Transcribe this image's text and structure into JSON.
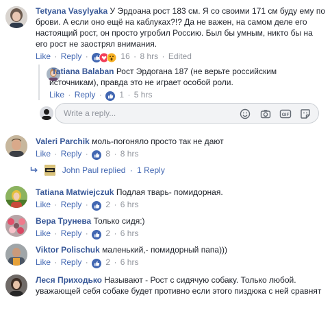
{
  "comments": [
    {
      "author": "Tetyana Vasylyaka",
      "text": "У Эрдоана рост 183 см. Я со своими 171 см буду ему по брови. А если оно ещё на каблуках?!? Да не важен, на самом деле его настоящий рост, он просто угробил Россию. Был бы умным, никто бы на его рост не заострял внимания.",
      "like": "Like",
      "reply": "Reply",
      "reaction_count": "16",
      "time": "8 hrs",
      "edited": "Edited",
      "reactions": [
        "like-reaction-icon",
        "love-reaction-icon",
        "wow-reaction-icon"
      ]
    },
    {
      "author": "Tatiana Balaban",
      "text": "Рост Эрдогана 187 (не верьте российским источникам), правда это не играет особой роли.",
      "like": "Like",
      "reply": "Reply",
      "reaction_count": "1",
      "time": "5 hrs",
      "reactions": [
        "like-reaction-icon"
      ]
    },
    {
      "author": "Valeri Parchik",
      "text": "моль-погоняло просто так не дают",
      "like": "Like",
      "reply": "Reply",
      "reaction_count": "8",
      "time": "8 hrs",
      "reactions": [
        "like-reaction-icon"
      ]
    },
    {
      "author": "Tatiana Matwiejczuk",
      "text": "Подлая тварь- помидорная.",
      "like": "Like",
      "reply": "Reply",
      "reaction_count": "2",
      "time": "6 hrs",
      "reactions": [
        "like-reaction-icon"
      ]
    },
    {
      "author": "Вера Трунева",
      "text": "Только сидя:)",
      "like": "Like",
      "reply": "Reply",
      "reaction_count": "2",
      "time": "6 hrs",
      "reactions": [
        "like-reaction-icon"
      ]
    },
    {
      "author": "Viktor Polischuk",
      "text": "маленький,- помидорный папа)))",
      "like": "Like",
      "reply": "Reply",
      "reaction_count": "2",
      "time": "6 hrs",
      "reactions": [
        "like-reaction-icon"
      ]
    },
    {
      "author": "Леся Приходько",
      "text": "Называют - Рост с сидячую собаку. Только любой. уважающей себя собаке будет противно если этого пиздюка с ней сравнят",
      "like": "",
      "reply": "",
      "reaction_count": "",
      "time": "",
      "reactions": []
    }
  ],
  "write_reply": {
    "placeholder": "Write a reply...",
    "tools": [
      "emoji-icon",
      "camera-icon",
      "gif-icon",
      "sticker-icon"
    ]
  },
  "replied_summary": {
    "name": "John Paul",
    "action": "replied",
    "separator": "·",
    "count_text": "1 Reply"
  },
  "colors": {
    "link": "#4267b2",
    "author": "#385898",
    "meta": "#90949c",
    "text": "#1d2129"
  }
}
